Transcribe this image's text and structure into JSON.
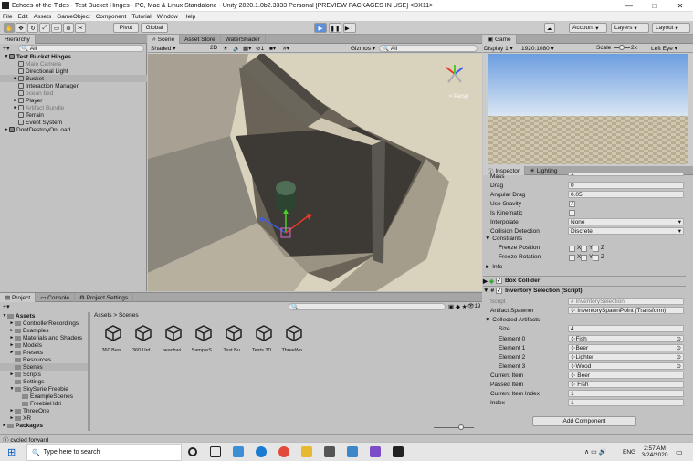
{
  "window": {
    "title": "Echoes-of-the-Tides - Test Bucket Hinges - PC, Mac & Linux Standalone - Unity 2020.1.0b2.3333 Personal [PREVIEW PACKAGES IN USE] <DX11>",
    "min": "—",
    "max": "□",
    "close": "✕"
  },
  "menu": [
    "File",
    "Edit",
    "Assets",
    "GameObject",
    "Component",
    "Tutorial",
    "Window",
    "Help"
  ],
  "toolbar": {
    "pivot": "Pivot",
    "global": "Global",
    "account": "Account",
    "layers": "Layers",
    "layout": "Layout"
  },
  "hierarchy": {
    "tab": "Hierarchy",
    "search": "All",
    "rows": [
      {
        "label": "Test Bucket Hinges",
        "indent": 0,
        "bold": true,
        "tri": "▼"
      },
      {
        "label": "Main Camera",
        "indent": 1,
        "gray": true
      },
      {
        "label": "Directional Light",
        "indent": 1
      },
      {
        "label": "Bucket",
        "indent": 1,
        "selected": true,
        "tri": "►"
      },
      {
        "label": "Interaction Manager",
        "indent": 1
      },
      {
        "label": "ocean bed",
        "indent": 1,
        "gray": true
      },
      {
        "label": "Player",
        "indent": 1,
        "tri": "►"
      },
      {
        "label": "Artifact Bundle",
        "indent": 1,
        "gray": true,
        "tri": "►"
      },
      {
        "label": "Terrain",
        "indent": 1
      },
      {
        "label": "Event System",
        "indent": 1
      },
      {
        "label": "DontDestroyOnLoad",
        "indent": 0,
        "tri": "►"
      }
    ]
  },
  "scene": {
    "tabs": [
      "Scene",
      "Asset Store",
      "WaterShader"
    ],
    "shaded": "Shaded",
    "mode2d": "2D",
    "gizmos": "Gizmos",
    "search": "All",
    "persp": "< Persp"
  },
  "game": {
    "tab": "Game",
    "display": "Display 1",
    "resolution": "1920:1080",
    "scale_label": "Scale",
    "scale": "2x",
    "eye": "Left Eye"
  },
  "inspector": {
    "tabs": [
      "Inspector",
      "Lighting"
    ],
    "rigid": [
      {
        "label": "Mass",
        "value": "1"
      },
      {
        "label": "Drag",
        "value": "0"
      },
      {
        "label": "Angular Drag",
        "value": "0.05"
      },
      {
        "label": "Use Gravity",
        "value": "✓",
        "check": true
      },
      {
        "label": "Is Kinematic",
        "value": "",
        "check": true
      },
      {
        "label": "Interpolate",
        "value": "None",
        "drop": true
      },
      {
        "label": "Collision Detection",
        "value": "Discrete",
        "drop": true
      }
    ],
    "constraints": "Constraints",
    "freeze_pos": "Freeze Position",
    "freeze_rot": "Freeze Rotation",
    "xyz": [
      "X",
      "Y",
      "Z"
    ],
    "info": "Info",
    "box_collider": "Box Collider",
    "inv_sel": "Inventory Selection (Script)",
    "script_label": "Script",
    "script_value": "InventorySelection",
    "spawner_label": "Artifact Spawner",
    "spawner_value": "InventorySpawnPoint (Transform)",
    "collected": "Collected Artifacts",
    "size_label": "Size",
    "size_value": "4",
    "elements": [
      {
        "label": "Element 0",
        "value": "Fish"
      },
      {
        "label": "Element 1",
        "value": "Beer"
      },
      {
        "label": "Element 2",
        "value": "Lighter"
      },
      {
        "label": "Element 3",
        "value": "Wood"
      }
    ],
    "current_item_label": "Current Item",
    "current_item_value": "Beer",
    "passed_item_label": "Passed Item",
    "passed_item_value": "Fish",
    "cur_index_label": "Current Item Index",
    "cur_index_value": "1",
    "index_label": "Index",
    "index_value": "1",
    "add_component": "Add Component"
  },
  "project": {
    "tabs": [
      "Project",
      "Console",
      "Project Settings"
    ],
    "badge": "19",
    "breadcrumb": [
      "Assets",
      "Scenes"
    ],
    "tree": [
      {
        "label": "Assets",
        "indent": 0,
        "bold": true,
        "tri": "▼"
      },
      {
        "label": "ControllerRecordings",
        "indent": 1,
        "tri": "►"
      },
      {
        "label": "Examples",
        "indent": 1,
        "tri": "►"
      },
      {
        "label": "Materials and Shaders",
        "indent": 1,
        "tri": "►"
      },
      {
        "label": "Models",
        "indent": 1,
        "tri": "►"
      },
      {
        "label": "Presets",
        "indent": 1,
        "tri": "►"
      },
      {
        "label": "Resources",
        "indent": 1
      },
      {
        "label": "Scenes",
        "indent": 1,
        "selected": true
      },
      {
        "label": "Scripts",
        "indent": 1,
        "tri": "►"
      },
      {
        "label": "Settings",
        "indent": 1
      },
      {
        "label": "SkySerie Freebie",
        "indent": 1,
        "tri": "▼"
      },
      {
        "label": "ExampleScenes",
        "indent": 2
      },
      {
        "label": "FreebieHdri",
        "indent": 2
      },
      {
        "label": "ThreeOne",
        "indent": 1,
        "tri": "►"
      },
      {
        "label": "XR",
        "indent": 1,
        "tri": "►"
      },
      {
        "label": "Packages",
        "indent": 0,
        "bold": true,
        "tri": "►"
      }
    ],
    "assets": [
      "360 Bea...",
      "360 Urd...",
      "beachwi...",
      "SampleS...",
      "Test Bu...",
      "Tests 3D...",
      "ThreeWo..."
    ]
  },
  "status": "cycled forward",
  "taskbar": {
    "search": "Type here to search",
    "lang": "ENG",
    "time": "2:57 AM",
    "date": "3/24/2020"
  }
}
